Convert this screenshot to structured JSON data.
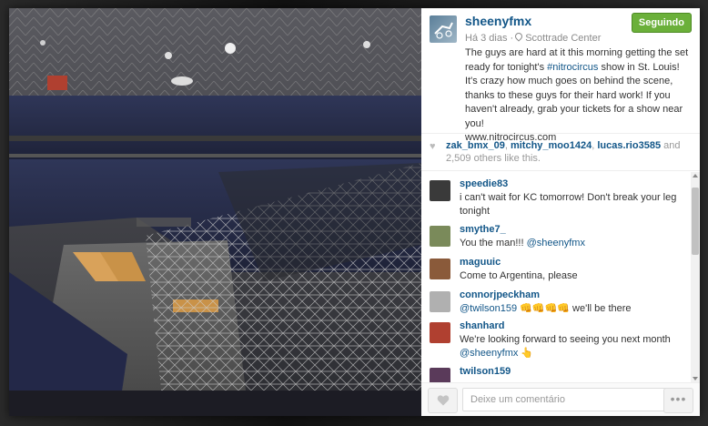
{
  "post": {
    "username": "sheenyfmx",
    "follow_label": "Seguindo",
    "time_ago": "Há 3 dias",
    "location": "Scottrade Center",
    "caption_before": "The guys are hard at it this morning getting the set ready for tonight's ",
    "caption_hashtag": "#nitrocircus",
    "caption_after": " show in St. Louis! It's crazy how much goes on behind the scene, thanks to these guys for their hard work! If you haven't already, grab your tickets for a show near you!\nwww.nitrocircus.com"
  },
  "likes": {
    "user1": "zak_bmx_09",
    "sep1": ", ",
    "user2": "mitchy_moo1424",
    "sep2": ", ",
    "user3": "lucas.rio3585",
    "and_text": " and 2,509 others like this."
  },
  "comments": [
    {
      "user": "speedie83",
      "text": "i can't wait for KC tomorrow! Don't break your leg tonight",
      "avatar_color": "#3a3a3a"
    },
    {
      "user": "smythe7_",
      "text_before": "You the man!!! ",
      "mention": "@sheenyfmx",
      "avatar_color": "#7a8a5a"
    },
    {
      "user": "maguuic",
      "text": "Come to Argentina, please",
      "avatar_color": "#8a5a3a"
    },
    {
      "user": "connorjpeckham",
      "mention": "@twilson159",
      "text_after": " 👊👊👊👊 we'll be there",
      "avatar_color": "#b0b0b0"
    },
    {
      "user": "shanhard",
      "text": "We're looking forward to seeing you next month",
      "mention": "@sheenyfmx",
      "emoji": "👆",
      "avatar_color": "#b04030"
    },
    {
      "user": "twilson159",
      "avatar_color": "#5a3a5a"
    }
  ],
  "footer": {
    "comment_placeholder": "Deixe um comentário",
    "more_label": "•••"
  },
  "icons": {
    "heart": "heart-icon",
    "location": "location-pin-icon",
    "more": "more-options-icon"
  },
  "colors": {
    "link": "#125688",
    "follow_button": "#6bb03a"
  }
}
